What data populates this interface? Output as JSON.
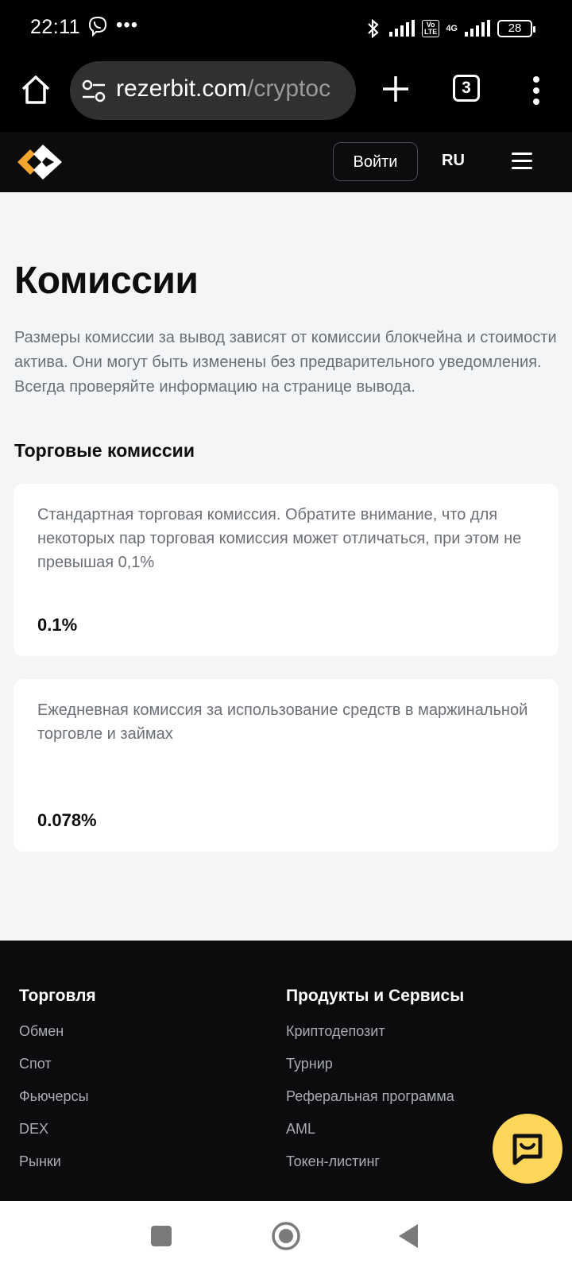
{
  "status_bar": {
    "time": "22:11",
    "dots": "•••",
    "lte_label": "Vo\nLTE",
    "net_label": "4G",
    "battery": "28"
  },
  "browser": {
    "url_host": "rezerbit.com",
    "url_path": "/cryptoc",
    "tab_count": "3"
  },
  "header": {
    "login_label": "Войти",
    "lang_label": "RU"
  },
  "main": {
    "title": "Комиссии",
    "description": "Размеры комиссии за вывод зависят от комиссии блокчейна и стоимости актива. Они могут быть изменены без предварительного уведомления. Всегда проверяйте информацию на странице вывода.",
    "section_title": "Торговые комиссии",
    "cards": [
      {
        "text": "Стандартная торговая комиссия. Обратите внимание, что для некоторых пар торговая комиссия может отличаться, при этом не превышая 0,1%",
        "value": "0.1%"
      },
      {
        "text": "Ежедневная комиссия за использование средств в маржинальной торговле и займах",
        "value": "0.078%"
      }
    ]
  },
  "footer": {
    "col1": {
      "title": "Торговля",
      "links": [
        "Обмен",
        "Спот",
        "Фьючерсы",
        "DEX",
        "Рынки"
      ]
    },
    "col2": {
      "title": "Продукты и Сервисы",
      "links": [
        "Криптодепозит",
        "Турнир",
        "Реферальная программа",
        "AML",
        "Токен-листинг"
      ]
    }
  },
  "colors": {
    "chat_accent": "#fdd65a",
    "logo_accent": "#f0a62f"
  }
}
